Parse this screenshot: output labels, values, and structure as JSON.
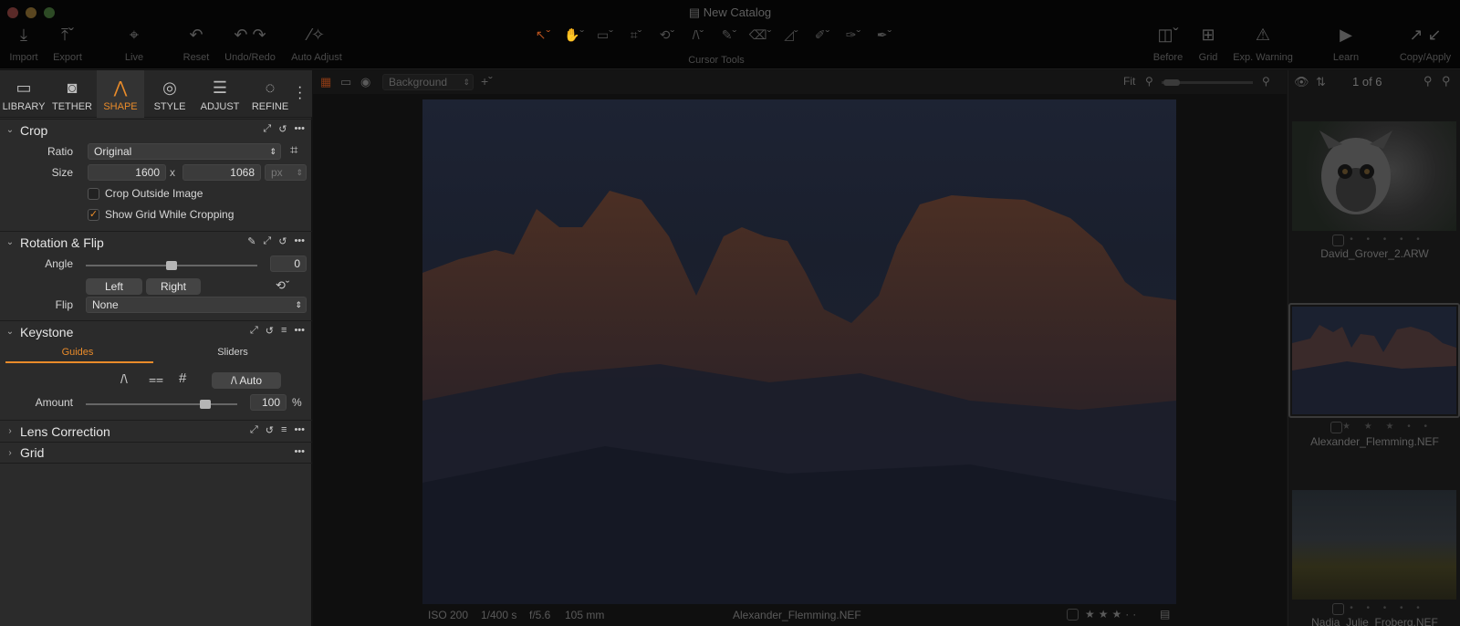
{
  "window": {
    "title": "New Catalog"
  },
  "toolbar": {
    "import": "Import",
    "export": "Export",
    "live": "Live",
    "reset": "Reset",
    "undo_redo": "Undo/Redo",
    "auto_adjust": "Auto Adjust",
    "cursor_tools": "Cursor Tools",
    "before": "Before",
    "grid": "Grid",
    "exp_warning": "Exp. Warning",
    "learn": "Learn",
    "copy_apply": "Copy/Apply"
  },
  "tool_tabs": [
    "LIBRARY",
    "TETHER",
    "SHAPE",
    "STYLE",
    "ADJUST",
    "REFINE"
  ],
  "active_tab": "SHAPE",
  "crop": {
    "title": "Crop",
    "ratio_label": "Ratio",
    "ratio_value": "Original",
    "size_label": "Size",
    "width": "1600",
    "x": "x",
    "height": "1068",
    "unit": "px",
    "crop_outside": "Crop Outside Image",
    "show_grid": "Show Grid While Cropping"
  },
  "rotation": {
    "title": "Rotation & Flip",
    "angle_label": "Angle",
    "angle_value": "0",
    "left": "Left",
    "right": "Right",
    "flip_label": "Flip",
    "flip_value": "None"
  },
  "keystone": {
    "title": "Keystone",
    "tab_guides": "Guides",
    "tab_sliders": "Sliders",
    "auto": "Auto",
    "amount_label": "Amount",
    "amount_value": "100",
    "amount_unit": "%"
  },
  "lens": {
    "title": "Lens Correction"
  },
  "grid_section": {
    "title": "Grid"
  },
  "viewer": {
    "layer": "Background",
    "fit": "Fit",
    "iso": "ISO 200",
    "shutter": "1/400 s",
    "aperture": "f/5.6",
    "focal": "105 mm",
    "filename": "Alexander_Flemming.NEF"
  },
  "browser": {
    "count": "1 of 6",
    "thumbs": [
      {
        "name": "David_Grover_2.ARW",
        "stars": "• • • • •"
      },
      {
        "name": "Alexander_Flemming.NEF",
        "stars": "★ ★ ★ • •"
      },
      {
        "name": "Nadja_Julie_Froberg.NEF",
        "stars": "• • • • •"
      }
    ]
  },
  "colors": {
    "accent": "#e98b2a"
  }
}
